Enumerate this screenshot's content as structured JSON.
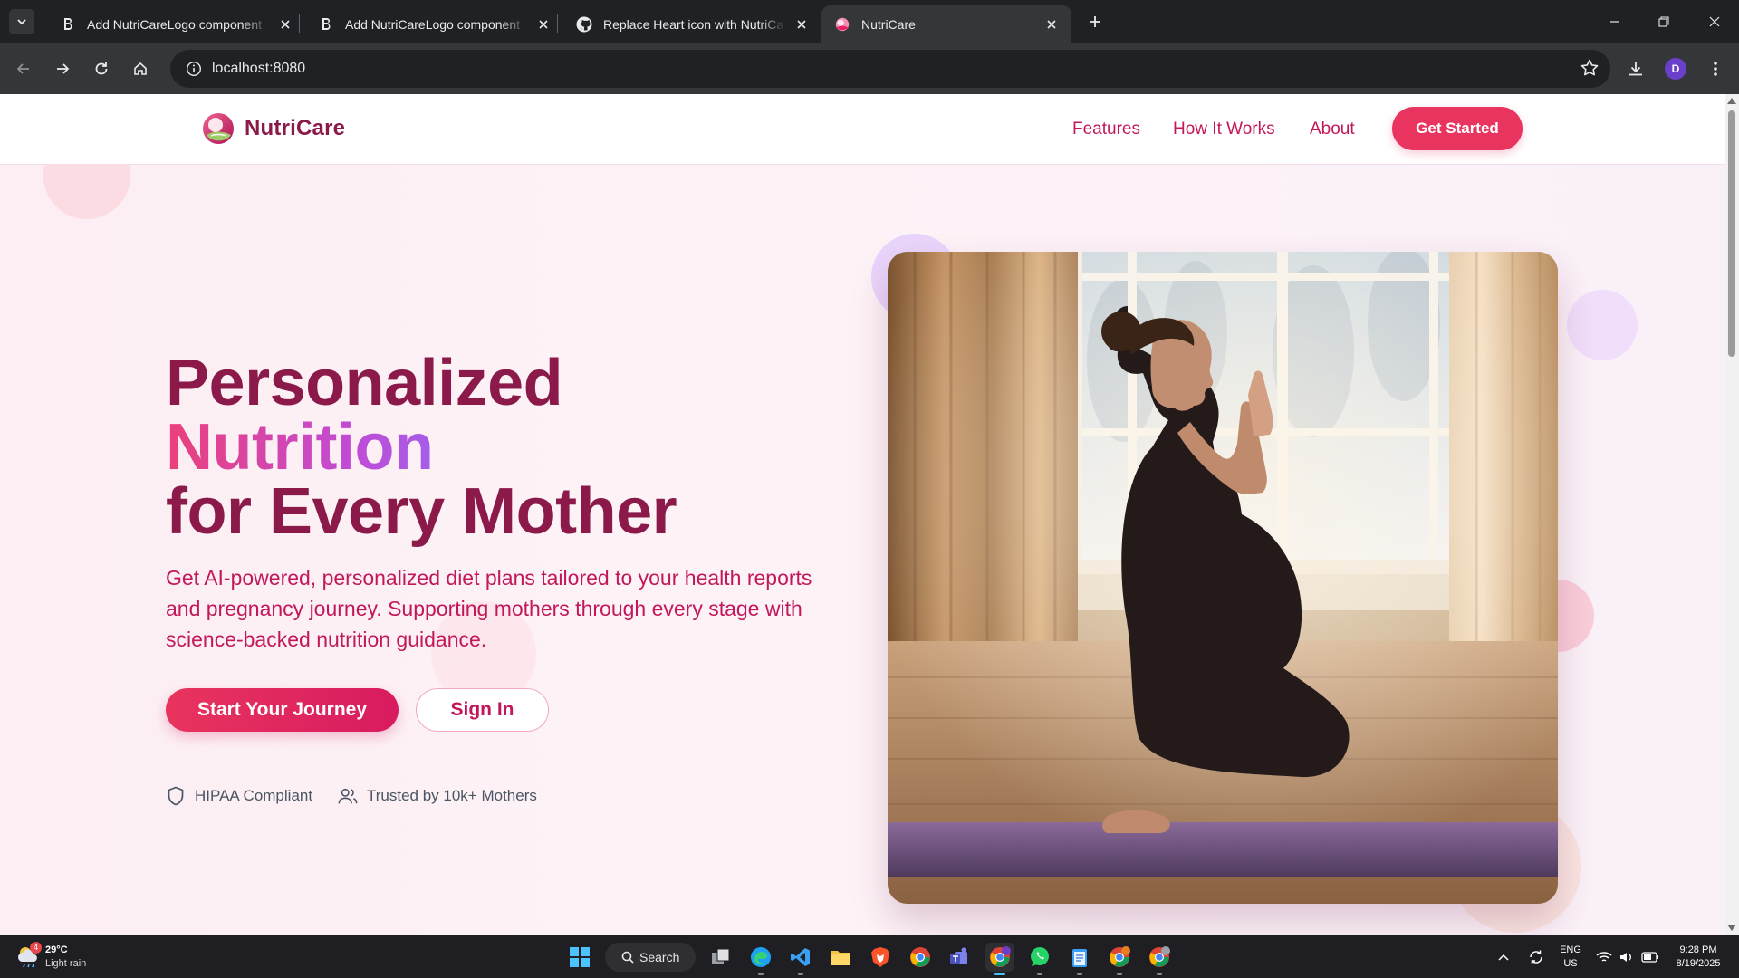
{
  "browser": {
    "tabs": [
      {
        "title": "Add NutriCareLogo component",
        "active": false,
        "favicon": "bolt-b-icon"
      },
      {
        "title": "Add NutriCareLogo component",
        "active": false,
        "favicon": "bolt-b-icon"
      },
      {
        "title": "Replace Heart icon with NutriCareLogo",
        "active": false,
        "favicon": "github-icon"
      },
      {
        "title": "NutriCare",
        "active": true,
        "favicon": "nutricare-icon"
      }
    ],
    "url": "localhost:8080",
    "profile_initial": "D"
  },
  "site": {
    "brand": "NutriCare",
    "nav": {
      "features": "Features",
      "how_it_works": "How It Works",
      "about": "About",
      "get_started": "Get Started"
    },
    "hero": {
      "title_line1": "Personalized",
      "title_line2": "Nutrition",
      "title_line3": "for Every Mother",
      "description": "Get AI-powered, personalized diet plans tailored to your health reports and pregnancy journey. Supporting mothers through every stage with science-backed nutrition guidance.",
      "primary_cta": "Start Your Journey",
      "secondary_cta": "Sign In",
      "badges": [
        {
          "label": "HIPAA Compliant",
          "icon": "shield-icon"
        },
        {
          "label": "Trusted by 10k+ Mothers",
          "icon": "users-icon"
        }
      ]
    },
    "colors": {
      "brand_dark": "#8b1a4a",
      "brand_pink": "#e8345e",
      "accent_text": "#c2185b",
      "gradient_start": "#ec407a",
      "gradient_end": "#a55ee8"
    }
  },
  "taskbar": {
    "weather": {
      "temp": "29°C",
      "condition": "Light rain",
      "badge": "4"
    },
    "search_label": "Search",
    "language": {
      "line1": "ENG",
      "line2": "US"
    },
    "clock": {
      "time": "9:28 PM",
      "date": "8/19/2025"
    }
  }
}
